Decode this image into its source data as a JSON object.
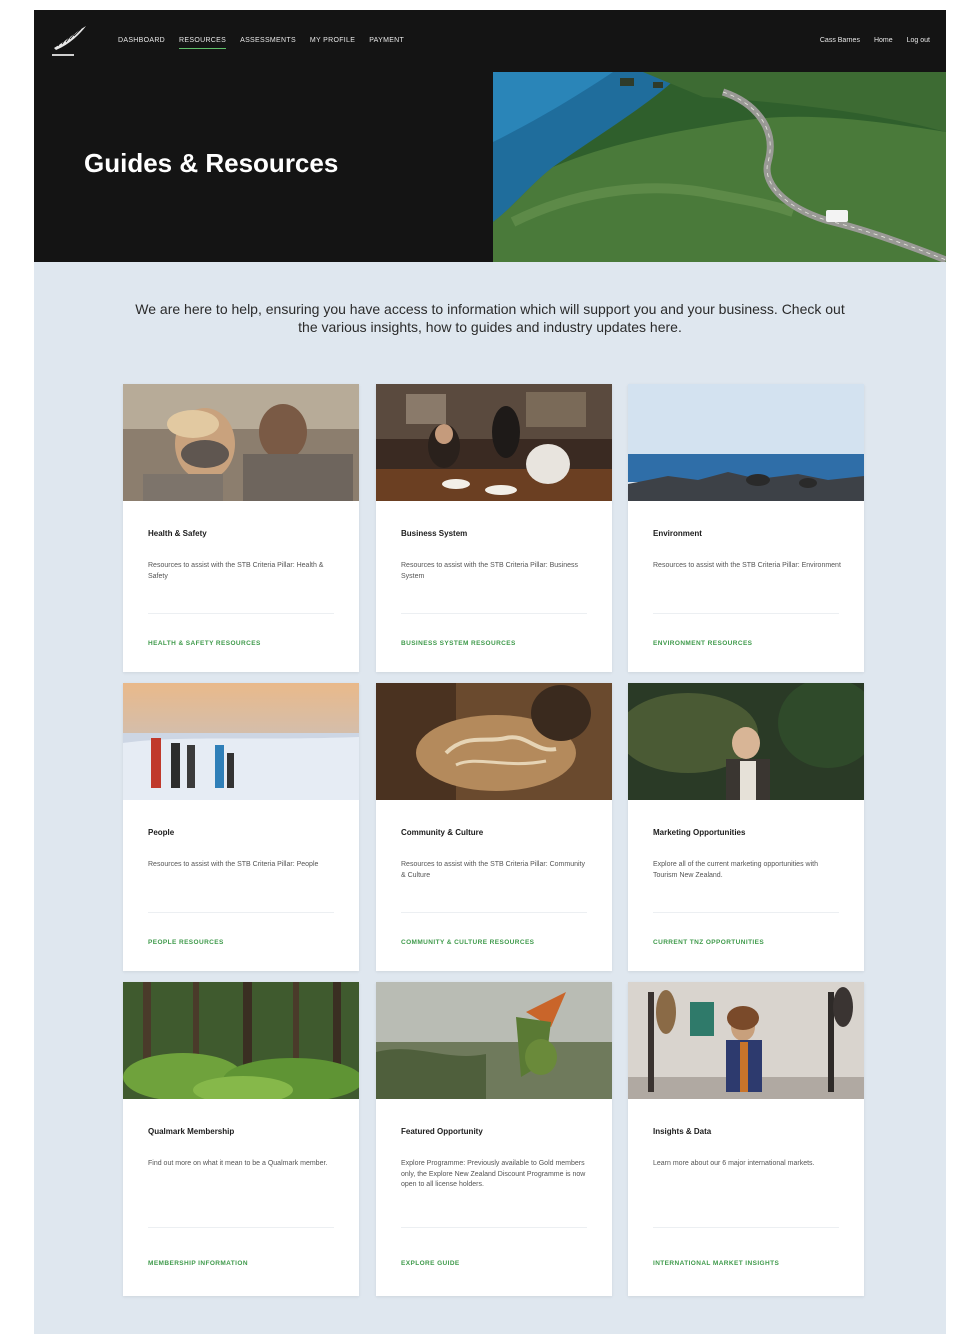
{
  "nav": {
    "items": [
      {
        "label": "DASHBOARD",
        "active": false
      },
      {
        "label": "RESOURCES",
        "active": true
      },
      {
        "label": "ASSESSMENTS",
        "active": false
      },
      {
        "label": "MY PROFILE",
        "active": false
      },
      {
        "label": "PAYMENT",
        "active": false
      }
    ],
    "user": "Cass Barnes",
    "home": "Home",
    "logout": "Log out"
  },
  "hero": {
    "title": "Guides & Resources"
  },
  "intro": "We are here to help, ensuring you have access to information which will support you and your business. Check out the various insights, how to guides and industry updates here.",
  "cards": [
    {
      "title": "Health & Safety",
      "description": "Resources to assist with the STB Criteria Pillar: Health & Safety",
      "link": "HEALTH & SAFETY RESOURCES",
      "image": "mud-spa-couple"
    },
    {
      "title": "Business System",
      "description": "Resources to assist with the STB Criteria Pillar: Business System",
      "link": "BUSINESS SYSTEM RESOURCES",
      "image": "restaurant-dining"
    },
    {
      "title": "Environment",
      "description": "Resources to assist with the STB Criteria Pillar: Environment",
      "link": "ENVIRONMENT RESOURCES",
      "image": "seals-on-rocks"
    },
    {
      "title": "People",
      "description": "Resources to assist with the STB Criteria Pillar: People",
      "link": "PEOPLE RESOURCES",
      "image": "snow-mountain-group"
    },
    {
      "title": "Community & Culture",
      "description": "Resources to assist with the STB Criteria Pillar: Community & Culture",
      "link": "COMMUNITY & CULTURE RESOURCES",
      "image": "wood-carving"
    },
    {
      "title": "Marketing Opportunities",
      "description": "Explore all of the current marketing opportunities with Tourism New Zealand.",
      "link": "CURRENT TNZ OPPORTUNITIES",
      "image": "man-in-forest"
    },
    {
      "title": "Qualmark Membership",
      "description": "Find out more on what it mean to be a Qualmark member.",
      "link": "MEMBERSHIP INFORMATION",
      "image": "fern-forest"
    },
    {
      "title": "Featured Opportunity",
      "description": "Explore Programme: Previously available to Gold members only, the Explore New Zealand Discount Programme is now open to all license holders.",
      "link": "EXPLORE GUIDE",
      "image": "kea-parrot"
    },
    {
      "title": "Insights & Data",
      "description": "Learn more about our 6 major international markets.",
      "link": "INTERNATIONAL MARKET INSIGHTS",
      "image": "woman-art-gallery"
    }
  ],
  "colors": {
    "accent": "#3f9a4b",
    "header": "#141414",
    "page_bg": "#dfe7ef"
  }
}
